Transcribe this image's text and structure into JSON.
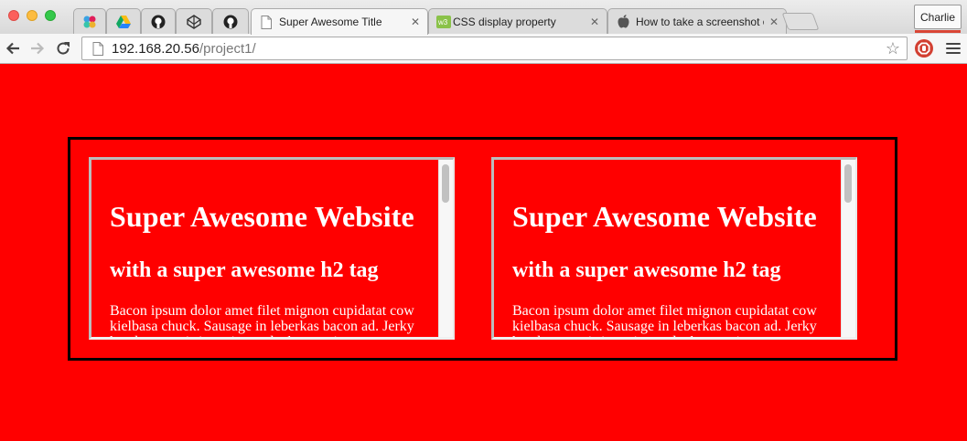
{
  "browser": {
    "tabs": [
      {
        "type": "pinned",
        "icon": "slack-icon"
      },
      {
        "type": "pinned",
        "icon": "google-drive-icon"
      },
      {
        "type": "pinned",
        "icon": "github-icon"
      },
      {
        "type": "pinned",
        "icon": "codepen-icon"
      },
      {
        "type": "pinned",
        "icon": "github-icon"
      },
      {
        "type": "normal",
        "title": "Super Awesome Title",
        "icon": "document-icon",
        "active": true
      },
      {
        "type": "normal",
        "title": "CSS display property",
        "icon": "w3schools-icon"
      },
      {
        "type": "normal",
        "title": "How to take a screenshot o",
        "icon": "apple-icon"
      }
    ],
    "profile_name": "Charlie",
    "url_host": "192.168.20.56",
    "url_path": "/project1/",
    "colors": {
      "page_background": "#ff0000",
      "tab_active": "#f6f6f6"
    }
  },
  "page": {
    "frames": [
      {
        "heading": "Super Awesome Website",
        "subheading": "with a super awesome h2 tag",
        "paragraph": "Bacon ipsum dolor amet filet mignon cupidatat cow kielbasa chuck. Sausage in leberkas bacon ad. Jerky hamburger tri-tip, enim turducken venison ut"
      },
      {
        "heading": "Super Awesome Website",
        "subheading": "with a super awesome h2 tag",
        "paragraph": "Bacon ipsum dolor amet filet mignon cupidatat cow kielbasa chuck. Sausage in leberkas bacon ad. Jerky hamburger tri-tip, enim turducken venison ut"
      }
    ]
  }
}
